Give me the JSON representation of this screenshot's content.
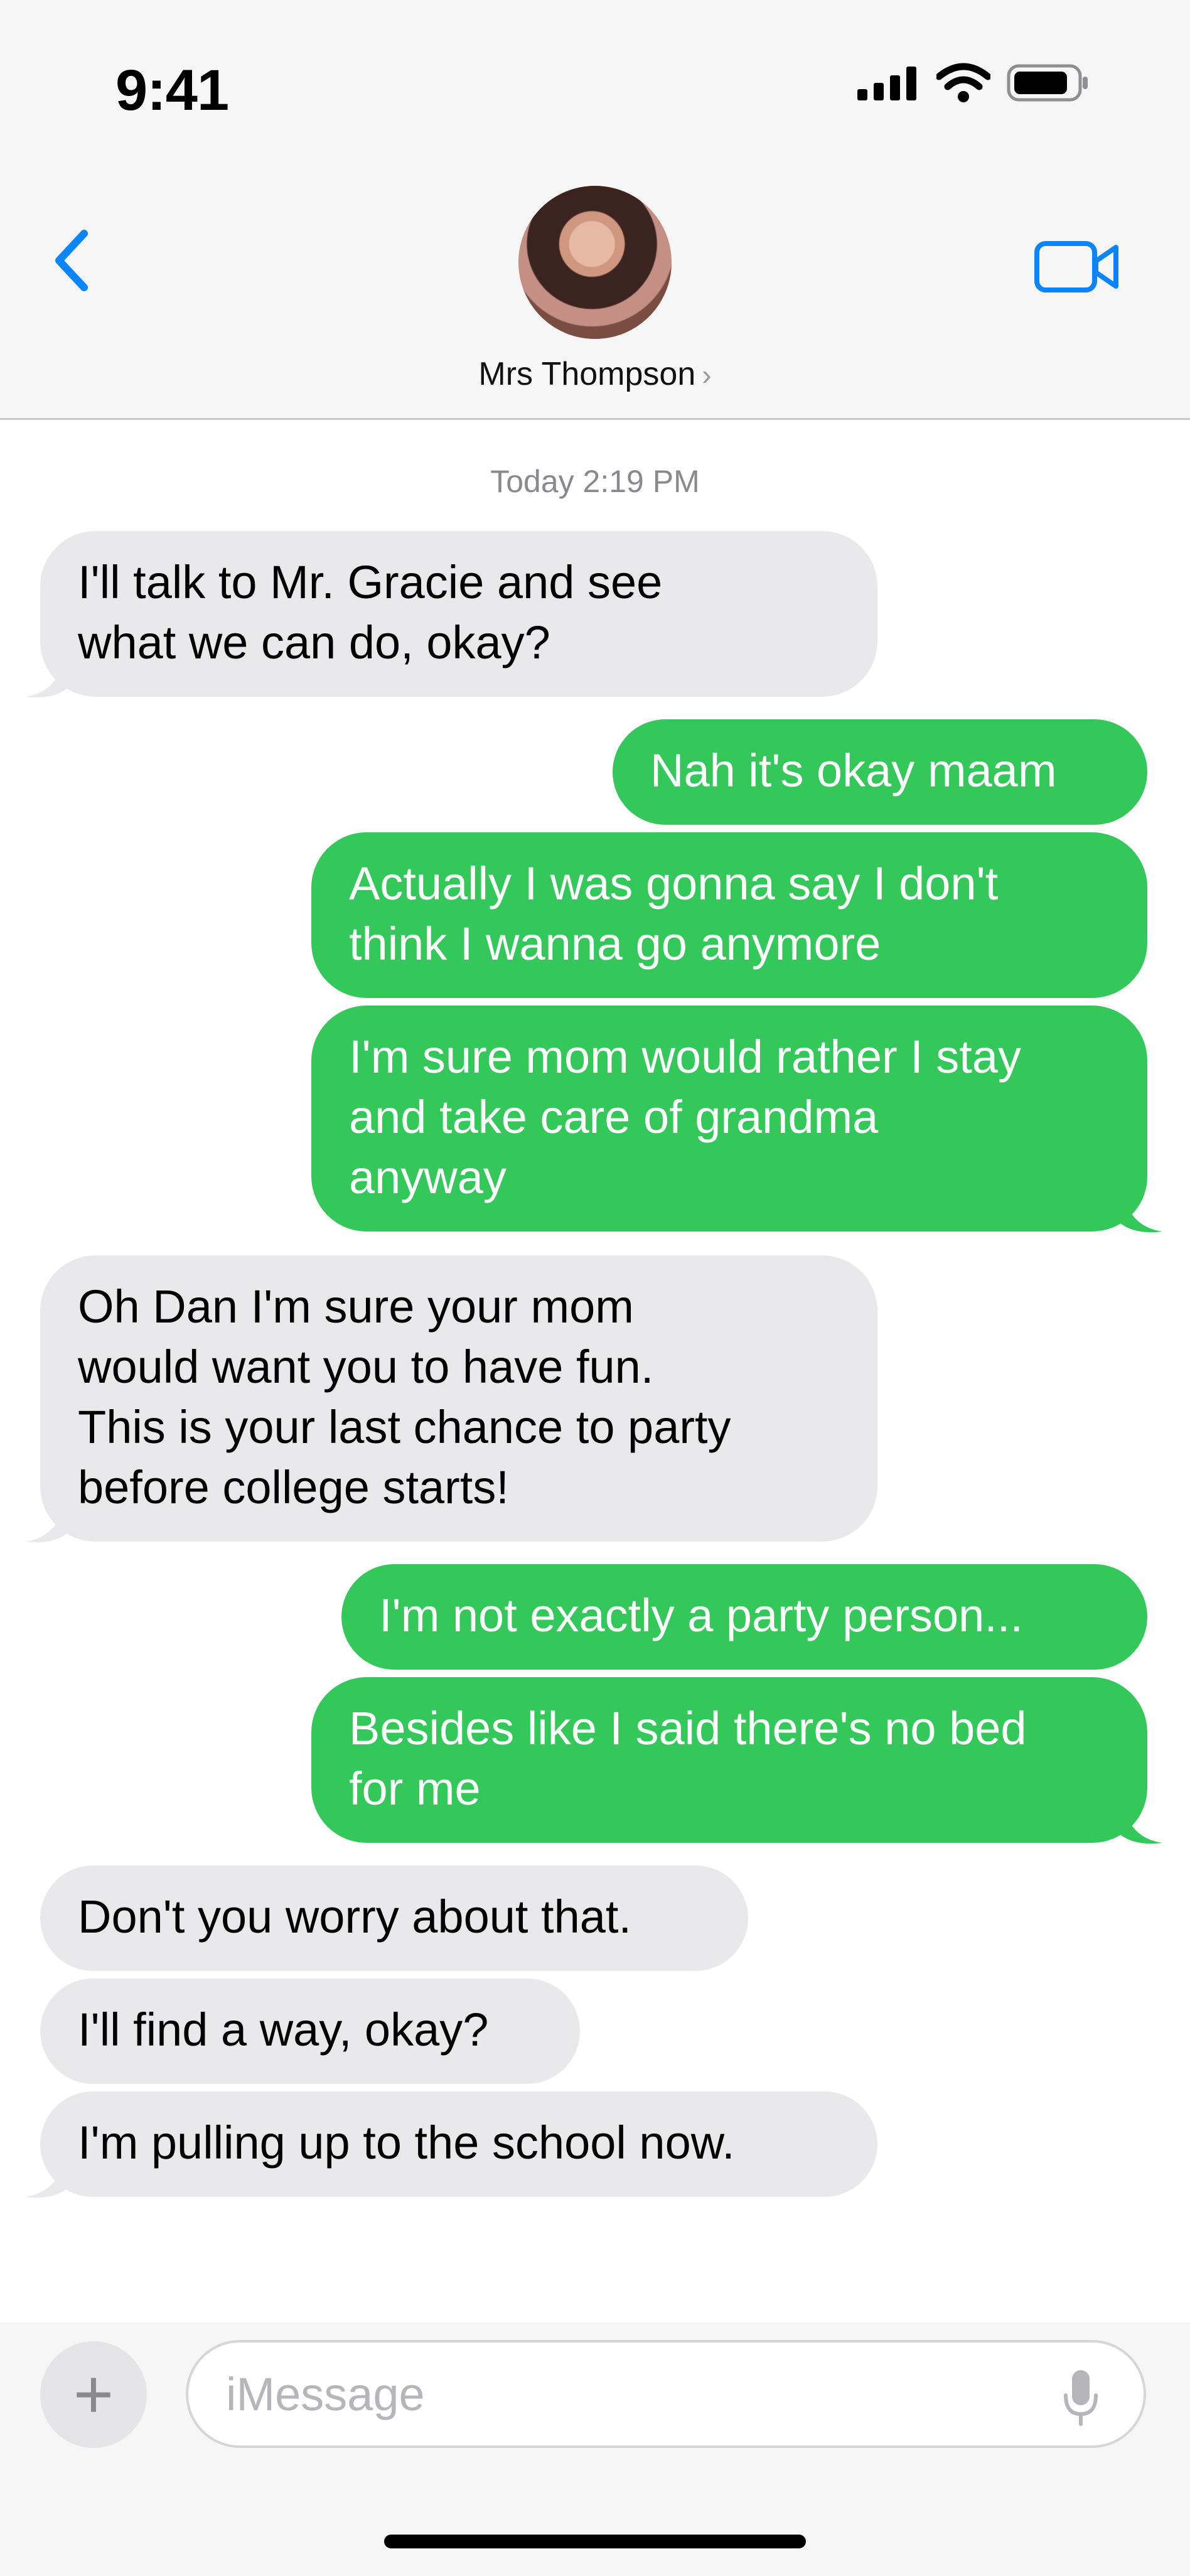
{
  "status_bar": {
    "time": "9:41"
  },
  "header": {
    "contact_name": "Mrs Thompson",
    "chevron": "›"
  },
  "thread": {
    "timestamp": "Today 2:19 PM",
    "messages": [
      {
        "from": "them",
        "text": "I'll talk to Mr. Gracie and see\nwhat we can do, okay?"
      },
      {
        "from": "me",
        "text": "Nah it's okay maam"
      },
      {
        "from": "me",
        "text": "Actually I was gonna say I don't\nthink I wanna go anymore"
      },
      {
        "from": "me",
        "text": "I'm sure mom would rather I stay\nand take care of grandma\nanyway"
      },
      {
        "from": "them",
        "text": "Oh Dan I'm sure your mom\nwould want you to have fun.\nThis is your last chance to party\nbefore college starts!"
      },
      {
        "from": "me",
        "text": "I'm not exactly a party person..."
      },
      {
        "from": "me",
        "text": "Besides like I said there's no bed\nfor me"
      },
      {
        "from": "them",
        "text": "Don't you worry about that."
      },
      {
        "from": "them",
        "text": "I'll find a way, okay?"
      },
      {
        "from": "them",
        "text": "I'm pulling up to the school now."
      }
    ]
  },
  "composer": {
    "placeholder": "iMessage",
    "plus_label": "+"
  },
  "colors": {
    "outgoing": "#34c759",
    "incoming": "#e9e9eb",
    "accent": "#0a84ff"
  },
  "icons": [
    "back-chevron-icon",
    "video-camera-icon",
    "signal-icon",
    "wifi-icon",
    "battery-icon",
    "microphone-icon"
  ]
}
